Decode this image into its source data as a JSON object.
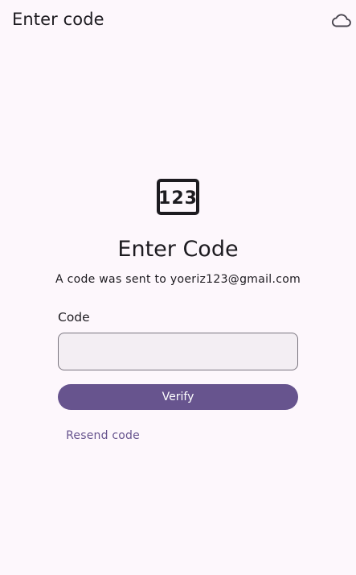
{
  "app_bar": {
    "title": "Enter code",
    "cloud_icon": "cloud-outline-icon"
  },
  "form": {
    "icon": "pin-123-icon",
    "icon_text": "123",
    "heading": "Enter Code",
    "subtitle": "A code was sent to yoeriz123@gmail.com",
    "code_label": "Code",
    "code_value": "",
    "verify_label": "Verify",
    "resend_label": "Resend code"
  },
  "colors": {
    "background": "#fdf7fc",
    "primary": "#67548e",
    "input_fill": "#f3eef3",
    "text": "#1d1b20"
  }
}
